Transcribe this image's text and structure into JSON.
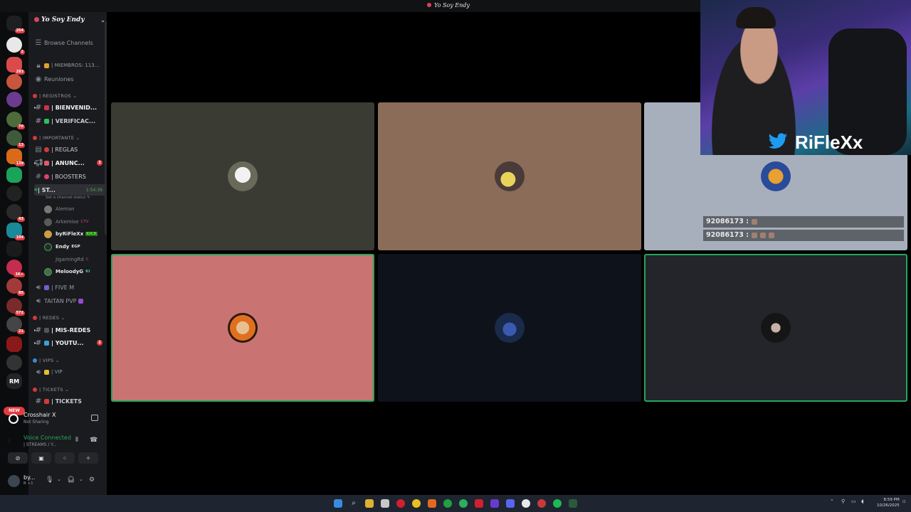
{
  "window": {
    "title": "Yo Soy Endy"
  },
  "server_rail": {
    "badges": [
      "254",
      "2",
      "283",
      "70",
      "13",
      "139",
      "43",
      "104",
      "1K+",
      "85",
      "572",
      "21"
    ],
    "rm_label": "RM",
    "new_label": "NEW"
  },
  "sidebar": {
    "guild_name": "Yo Soy Endy",
    "browse": "Browse Channels",
    "miembros": "| MIEMBROS: 113...",
    "reuniones": "Reuniones",
    "categories": {
      "registros": "| REGISTROS",
      "importante": "| IMPORTANTE",
      "redes": "| REDES",
      "vips": "| VIPS",
      "tickets": "| TICKETS"
    },
    "channels": {
      "bienvenidas": "| BIENVENID...",
      "verificacion": "| VERIFICAC...",
      "reglas": "| REGLAS",
      "anuncios": "| ANUNC...",
      "anuncios_badge": "3",
      "boosters": "| BOOSTERS",
      "streams": "| ST...",
      "streams_time": "1:54:39",
      "streams_status": "Set a channel status",
      "five_m": "| FIVE M",
      "taitan": "TAITAN PVP",
      "mis_redes": "| MIS-REDES",
      "youtube": "| YOUTU...",
      "youtube_badge": "2",
      "vip": "| VIP",
      "tickets": "| TICKETS"
    },
    "members": [
      {
        "name": "Aleman",
        "tag": ""
      },
      {
        "name": "Arkemise",
        "tag": "CTV"
      },
      {
        "name": "byRiFleXx",
        "tag": "KICK"
      },
      {
        "name": "Endy",
        "tag": "EGP"
      },
      {
        "name": "JigamingRd",
        "tag": "C"
      },
      {
        "name": "MeloodyG",
        "tag": "KI"
      }
    ]
  },
  "activity": {
    "name": "Crosshair X",
    "status": "Not Sharing"
  },
  "voice": {
    "title": "Voice Connected",
    "channel": "| STREAMS / Y..."
  },
  "user": {
    "name": "by...",
    "status": "B +1"
  },
  "webcam": {
    "handle": "RiFleXx"
  },
  "chat": [
    {
      "text": "92086173 :"
    },
    {
      "text": "92086173 :"
    }
  ],
  "taskbar": {
    "time": "8:59 PM",
    "date": "10/26/2025"
  },
  "colors": {
    "tile1": "#3a3b33",
    "tile2": "#8a6c58",
    "tile3": "#a8afbc",
    "tile4": "#c97473",
    "tile5": "#0e121a",
    "tile6": "#23252a",
    "accent_green": "#23a55a"
  }
}
